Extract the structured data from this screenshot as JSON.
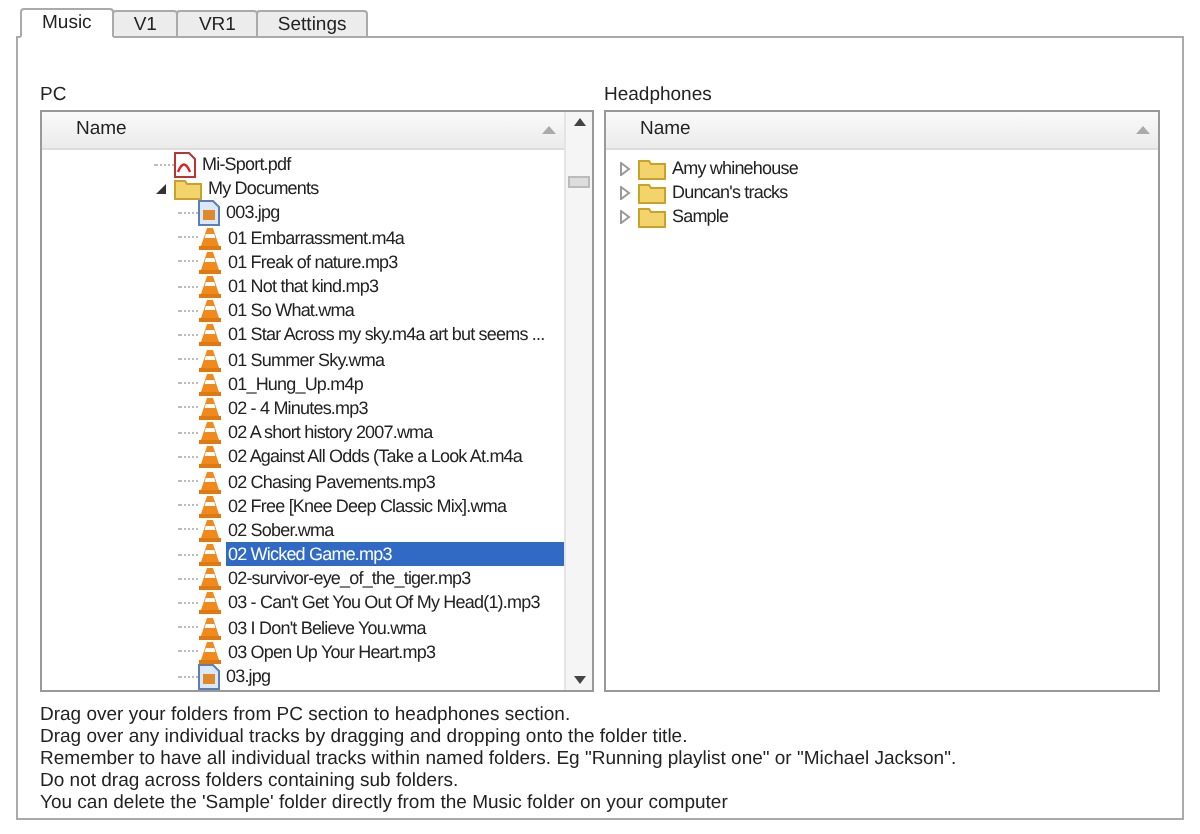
{
  "tabs": [
    {
      "label": "Music",
      "selected": true
    },
    {
      "label": "V1",
      "selected": false
    },
    {
      "label": "VR1",
      "selected": false
    },
    {
      "label": "Settings",
      "selected": false
    }
  ],
  "pc": {
    "label": "PC",
    "column": "Name",
    "items": [
      {
        "kind": "pdf",
        "name": "Mi-Sport.pdf",
        "selected": false
      },
      {
        "kind": "folder",
        "name": "My Documents",
        "selected": false,
        "expanded": true,
        "children": [
          {
            "kind": "image",
            "name": "003.jpg",
            "selected": false
          },
          {
            "kind": "media",
            "name": "01 Embarrassment.m4a",
            "selected": false
          },
          {
            "kind": "media",
            "name": "01 Freak of nature.mp3",
            "selected": false
          },
          {
            "kind": "media",
            "name": "01 Not that kind.mp3",
            "selected": false
          },
          {
            "kind": "media",
            "name": "01 So What.wma",
            "selected": false
          },
          {
            "kind": "media",
            "name": "01 Star Across my sky.m4a art but seems ...",
            "selected": false
          },
          {
            "kind": "media",
            "name": "01 Summer Sky.wma",
            "selected": false
          },
          {
            "kind": "media",
            "name": "01_Hung_Up.m4p",
            "selected": false
          },
          {
            "kind": "media",
            "name": "02 - 4 Minutes.mp3",
            "selected": false
          },
          {
            "kind": "media",
            "name": "02 A short history 2007.wma",
            "selected": false
          },
          {
            "kind": "media",
            "name": "02 Against All Odds (Take a Look At.m4a",
            "selected": false
          },
          {
            "kind": "media",
            "name": "02 Chasing Pavements.mp3",
            "selected": false
          },
          {
            "kind": "media",
            "name": "02 Free [Knee Deep Classic Mix].wma",
            "selected": false
          },
          {
            "kind": "media",
            "name": "02 Sober.wma",
            "selected": false
          },
          {
            "kind": "media",
            "name": "02 Wicked Game.mp3",
            "selected": true
          },
          {
            "kind": "media",
            "name": "02-survivor-eye_of_the_tiger.mp3",
            "selected": false
          },
          {
            "kind": "media",
            "name": "03 - Can't Get You Out Of My Head(1).mp3",
            "selected": false
          },
          {
            "kind": "media",
            "name": "03 I Don't Believe You.wma",
            "selected": false
          },
          {
            "kind": "media",
            "name": "03 Open Up Your Heart.mp3",
            "selected": false
          },
          {
            "kind": "image",
            "name": "03.jpg",
            "selected": false
          }
        ]
      }
    ]
  },
  "headphones": {
    "label": "Headphones",
    "column": "Name",
    "items": [
      {
        "kind": "folder",
        "name": "Amy whinehouse",
        "selected": false,
        "expanded": false
      },
      {
        "kind": "folder",
        "name": "Duncan's tracks",
        "selected": false,
        "expanded": false
      },
      {
        "kind": "folder",
        "name": "Sample",
        "selected": false,
        "expanded": false
      }
    ]
  },
  "instructions": [
    "Drag over your folders from PC section to headphones section.",
    "Drag over any individual tracks by dragging and dropping onto the folder title.",
    "Remember to have all individual tracks within named folders. Eg \"Running playlist one\" or \"Michael Jackson\".",
    "Do not drag across folders containing sub folders.",
    "You can delete the 'Sample' folder directly from the Music folder on your computer"
  ]
}
